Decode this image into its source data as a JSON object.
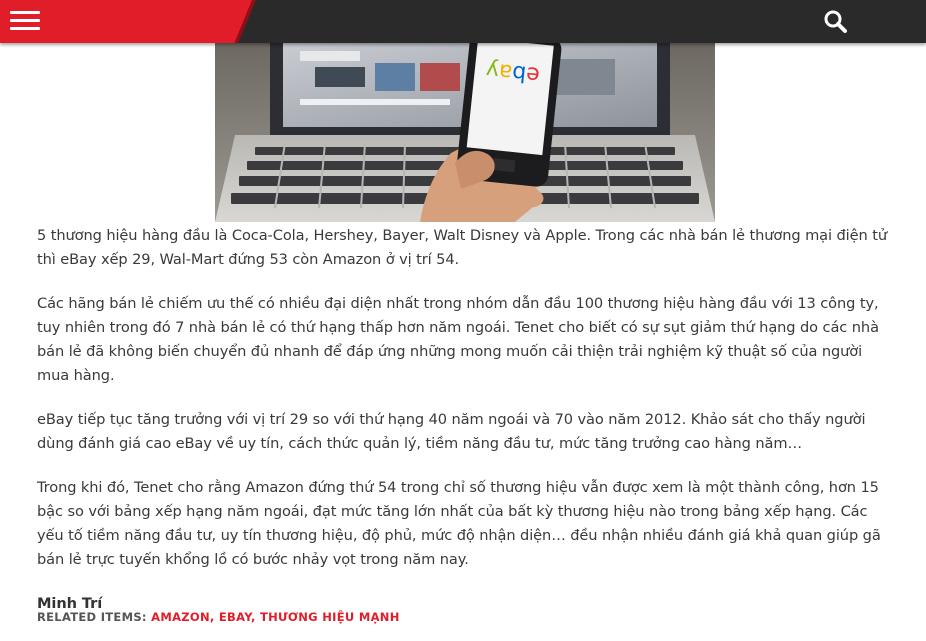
{
  "header": {
    "menu_icon": "hamburger-icon",
    "search_icon": "search-icon",
    "accent_color": "#e11d2a",
    "bar_color": "#2a2a2a"
  },
  "hero": {
    "screen_logo": "ebay"
  },
  "article": {
    "paragraphs": [
      "5 thương hiệu hàng đầu là Coca-Cola, Hershey, Bayer, Walt Disney và Apple. Trong các nhà bán lẻ thương mại điện tử thì eBay xếp 29, Wal-Mart đứng 53 còn Amazon ở vị trí 54.",
      "Các hãng bán lẻ chiếm ưu thế có nhiều đại diện nhất trong nhóm dẫn đầu 100 thương hiệu hàng đầu với 13 công ty, tuy nhiên trong đó 7 nhà bán lẻ có thứ hạng thấp hơn năm ngoái. Tenet cho biết có sự sụt giảm thứ hạng do các nhà bán lẻ đã không biến chuyển đủ nhanh để đáp ứng những mong muốn cải thiện trải nghiệm kỹ thuật số của người mua hàng.",
      "eBay tiếp tục tăng trưởng với vị trí 29 so với thứ hạng 40 năm ngoái và 70 vào năm 2012. Khảo sát cho thấy người dùng đánh giá cao eBay về uy tín, cách thức quản lý, tiềm năng đầu tư, mức tăng trưởng cao hàng năm…",
      "Trong khi đó, Tenet cho rằng Amazon đứng thứ 54 trong chỉ số thương hiệu vẫn được xem là một thành công, hơn 15 bậc so với bảng xếp hạng năm ngoái, đạt mức tăng lớn nhất của bất kỳ thương hiệu nào trong bảng xếp hạng. Các yếu tố tiềm năng đầu tư, uy tín thương hiệu, độ phủ, mức độ nhận diện… đều nhận nhiều đánh giá khả quan giúp gã bán lẻ trực tuyến khổng lồ có bước nhảy vọt trong năm nay."
    ],
    "author": "Minh Trí"
  },
  "related": {
    "label": "RELATED ITEMS:",
    "items": [
      "AMAZON",
      "EBAY",
      "THƯƠNG HIỆU MẠNH"
    ],
    "separator": ","
  }
}
